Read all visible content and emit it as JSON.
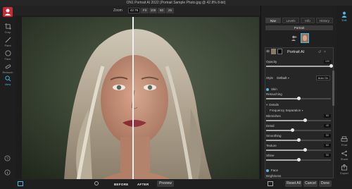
{
  "app": {
    "title": "ON1 Portrait AI 2022 (Portrait Sample Photo.jpg @ 42.8% 8-bit)"
  },
  "toolbar": {
    "zoom_label": "Zoom",
    "zoom_value": "42.76",
    "zoom_buttons": [
      "Fit",
      "100",
      "50",
      "25"
    ]
  },
  "left_tools": [
    {
      "label": "Crop",
      "icon": "crop-icon"
    },
    {
      "label": "Paint",
      "icon": "brush-icon"
    },
    {
      "label": "Face",
      "icon": "face-icon"
    },
    {
      "label": "Retouch",
      "icon": "bandage-icon"
    },
    {
      "label": "View",
      "icon": "view-icon"
    }
  ],
  "right_rail": [
    {
      "label": "Edit",
      "icon": "person-icon"
    },
    {
      "label": "Print",
      "icon": "printer-icon"
    },
    {
      "label": "Share",
      "icon": "share-icon"
    },
    {
      "label": "Export",
      "icon": "export-icon"
    }
  ],
  "panel": {
    "tabs": [
      "Nav",
      "Levels",
      "Info",
      "History"
    ],
    "active_tab": "Nav",
    "mode_button": "Portrait",
    "header_title": "Portrait AI",
    "opacity_label": "Opacity",
    "opacity_value": "100",
    "style_label": "Style",
    "style_value": "Default",
    "auto_button": "Auto On",
    "skin_section": "Skin",
    "retouching_label": "Retouching",
    "details_section": "Details",
    "freq_sep_label": "Frequency Separation",
    "sliders": [
      {
        "label": "Blemishes",
        "value": 60
      },
      {
        "label": "Detail",
        "value": 40
      },
      {
        "label": "Smoothing",
        "value": 50
      },
      {
        "label": "Texture",
        "value": 60
      },
      {
        "label": "Shine",
        "value": 50
      }
    ],
    "face_section": "Face",
    "brightness_label": "Brightness"
  },
  "bottom": {
    "preview_button": "Preview",
    "before_label": "BEFORE",
    "after_label": "AFTER",
    "reset_button": "Reset All",
    "cancel_button": "Cancel",
    "done_button": "Done"
  },
  "colors": {
    "accent": "#4fb8e0",
    "brand": "#c62a35"
  }
}
